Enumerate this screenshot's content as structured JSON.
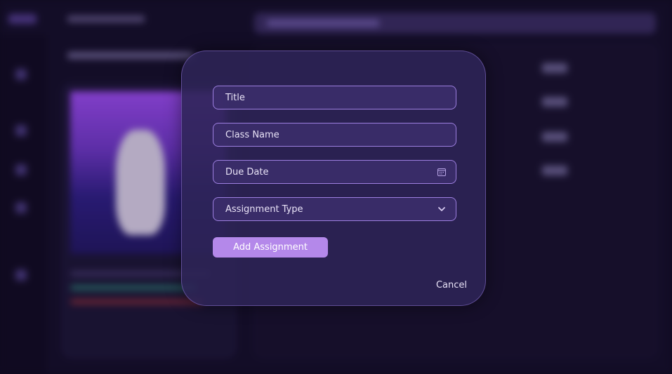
{
  "modal": {
    "fields": {
      "title": {
        "placeholder": "Title"
      },
      "class_name": {
        "placeholder": "Class Name"
      },
      "due_date": {
        "placeholder": "Due Date",
        "icon": "calendar-icon"
      },
      "assignment_type": {
        "placeholder": "Assignment Type",
        "icon": "chevron-down-icon"
      }
    },
    "add_button_label": "Add Assignment",
    "cancel_label": "Cancel"
  },
  "colors": {
    "page_background": "#120d24",
    "modal_background": "#2e2456",
    "field_border": "#9d7fe0",
    "accent_button": "#b488ea",
    "text": "#e9e3f7"
  }
}
